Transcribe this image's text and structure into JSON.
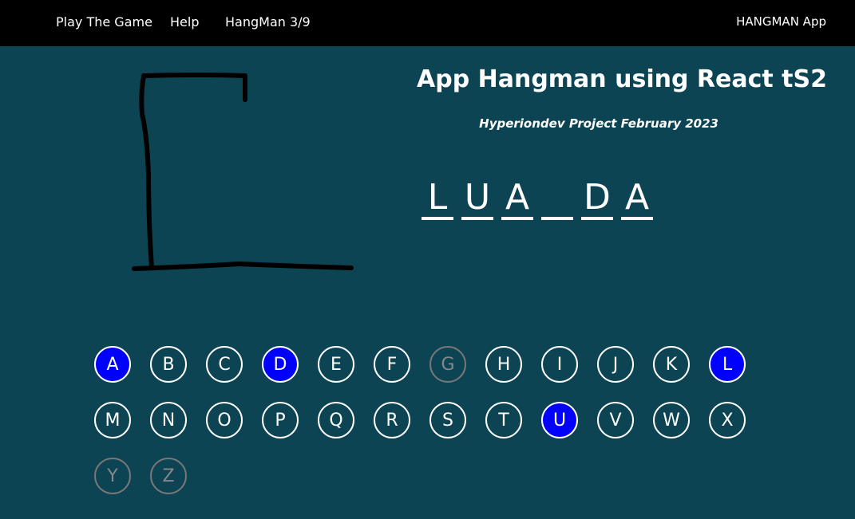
{
  "nav": {
    "play": "Play The Game",
    "help": "Help",
    "counter": "HangMan 3/9",
    "brand": "HANGMAN App"
  },
  "header": {
    "title": "App Hangman using React tS2",
    "subtitle": "Hyperiondev Project February 2023"
  },
  "word": {
    "slots": [
      "L",
      "U",
      "A",
      "",
      "D",
      "A"
    ]
  },
  "keyboard": {
    "keys": [
      {
        "letter": "A",
        "state": "used"
      },
      {
        "letter": "B",
        "state": "available"
      },
      {
        "letter": "C",
        "state": "available"
      },
      {
        "letter": "D",
        "state": "used"
      },
      {
        "letter": "E",
        "state": "available"
      },
      {
        "letter": "F",
        "state": "available"
      },
      {
        "letter": "G",
        "state": "disabled"
      },
      {
        "letter": "H",
        "state": "available"
      },
      {
        "letter": "I",
        "state": "available"
      },
      {
        "letter": "J",
        "state": "available"
      },
      {
        "letter": "K",
        "state": "available"
      },
      {
        "letter": "L",
        "state": "used"
      },
      {
        "letter": "M",
        "state": "available"
      },
      {
        "letter": "N",
        "state": "available"
      },
      {
        "letter": "O",
        "state": "available"
      },
      {
        "letter": "P",
        "state": "available"
      },
      {
        "letter": "Q",
        "state": "available"
      },
      {
        "letter": "R",
        "state": "available"
      },
      {
        "letter": "S",
        "state": "available"
      },
      {
        "letter": "T",
        "state": "available"
      },
      {
        "letter": "U",
        "state": "used"
      },
      {
        "letter": "V",
        "state": "available"
      },
      {
        "letter": "W",
        "state": "available"
      },
      {
        "letter": "X",
        "state": "available"
      },
      {
        "letter": "Y",
        "state": "disabled"
      },
      {
        "letter": "Z",
        "state": "disabled"
      }
    ]
  },
  "colors": {
    "background": "#0d4454",
    "navbar": "#000000",
    "used_key": "#0000ff",
    "disabled_key_border": "#777777"
  }
}
